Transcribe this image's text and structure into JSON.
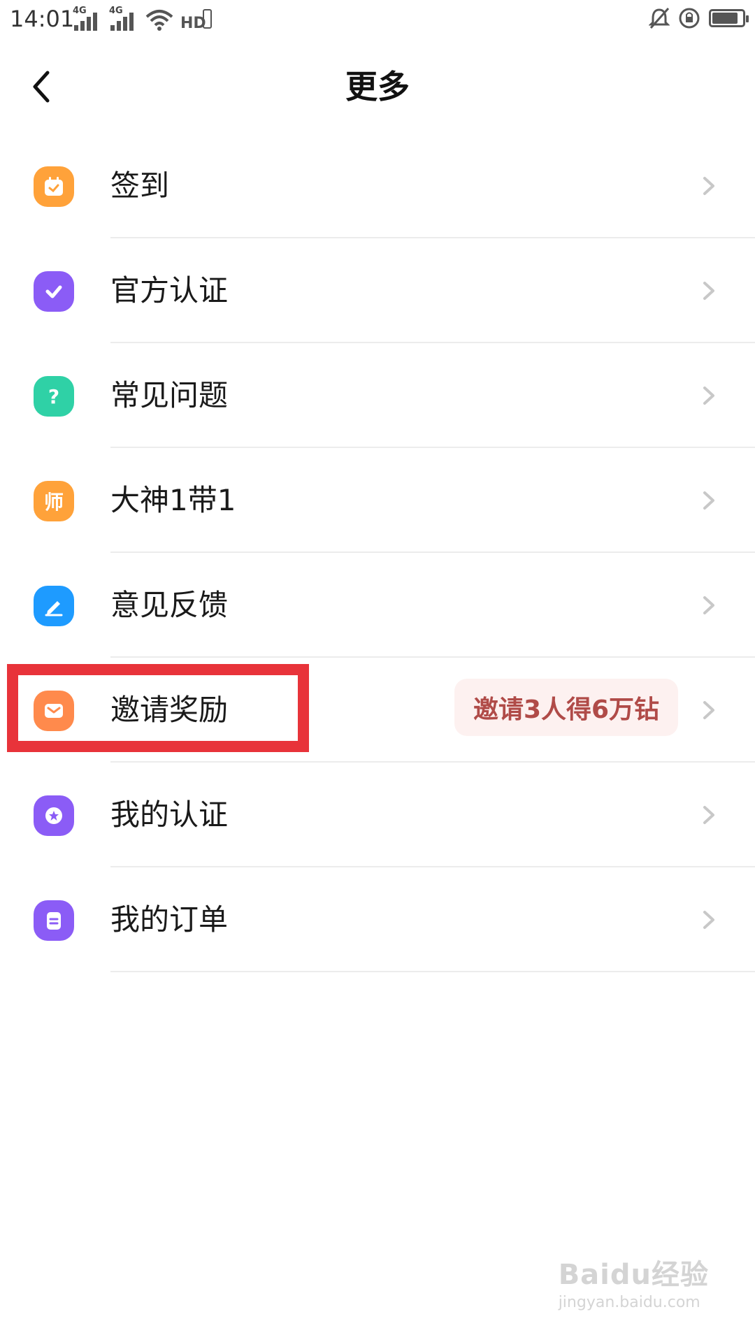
{
  "status_bar": {
    "time": "14:01",
    "signal_labels": [
      "4G",
      "4G"
    ],
    "hd_label": "HD",
    "icons": [
      "signal-icon",
      "signal-icon",
      "wifi-icon",
      "hd-icon",
      "mute-icon",
      "rotation-lock-icon",
      "battery-icon"
    ]
  },
  "nav": {
    "title": "更多",
    "back_icon": "chevron-left-icon"
  },
  "menu": {
    "items": [
      {
        "label": "签到",
        "icon": "calendar-check-icon",
        "color": "#ffa23a"
      },
      {
        "label": "官方认证",
        "icon": "checkmark-icon",
        "color": "#8b5cf6"
      },
      {
        "label": "常见问题",
        "icon": "question-icon",
        "glyph": "?",
        "color": "#2fd1a6"
      },
      {
        "label": "大神1带1",
        "icon": "teacher-icon",
        "glyph": "师",
        "color": "#ffa23a"
      },
      {
        "label": "意见反馈",
        "icon": "pencil-icon",
        "color": "#1e9bff"
      },
      {
        "label": "邀请奖励",
        "icon": "envelope-icon",
        "color": "#ff8a4c",
        "badge": "邀请3人得6万钻"
      },
      {
        "label": "我的认证",
        "icon": "badge-star-icon",
        "color": "#8b5cf6"
      },
      {
        "label": "我的订单",
        "icon": "clipboard-icon",
        "color": "#8b5cf6"
      }
    ]
  },
  "watermark": {
    "line1": "Baidu经验",
    "line2": "jingyan.baidu.com"
  },
  "colors": {
    "highlight": "#e8333a",
    "badge_bg": "#fdf1f0",
    "badge_text": "#b04b48"
  }
}
